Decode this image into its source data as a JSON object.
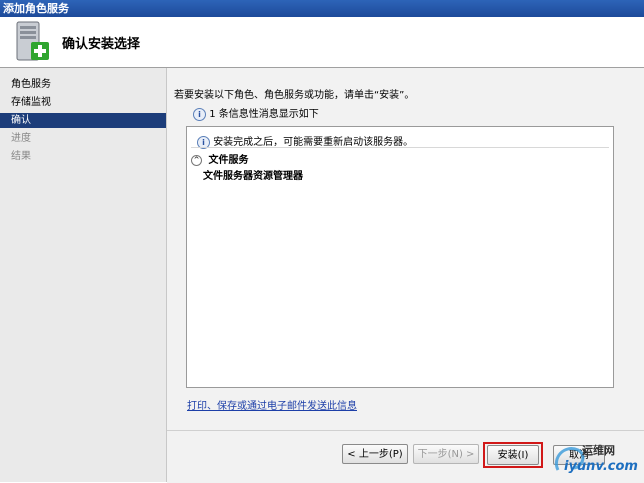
{
  "window": {
    "title": "添加角色服务"
  },
  "header": {
    "heading": "确认安装选择"
  },
  "sidebar": {
    "items": [
      {
        "label": "角色服务",
        "state": "normal"
      },
      {
        "label": "存储监视",
        "state": "normal"
      },
      {
        "label": "确认",
        "state": "active"
      },
      {
        "label": "进度",
        "state": "disabled"
      },
      {
        "label": "结果",
        "state": "disabled"
      }
    ]
  },
  "main": {
    "intro": "若要安装以下角色、角色服务或功能，请单击“安装”。",
    "info_message": "1 条信息性消息显示如下",
    "results": {
      "restart_notice": "安装完成之后，可能需要重新启动该服务器。",
      "role": "文件服务",
      "role_service": "文件服务器资源管理器"
    },
    "link": "打印、保存或通过电子邮件发送此信息"
  },
  "buttons": {
    "previous": "< 上一步(P)",
    "next": "下一步(N) >",
    "install": "安装(I)",
    "cancel": "取消"
  },
  "watermark": {
    "line1": "运维网",
    "line2": "iyunv.com"
  },
  "colors": {
    "titlebar": "#2d64b8",
    "sidebar_active": "#1c3d7a",
    "highlight": "#d11818",
    "link": "#1d3fa8"
  }
}
